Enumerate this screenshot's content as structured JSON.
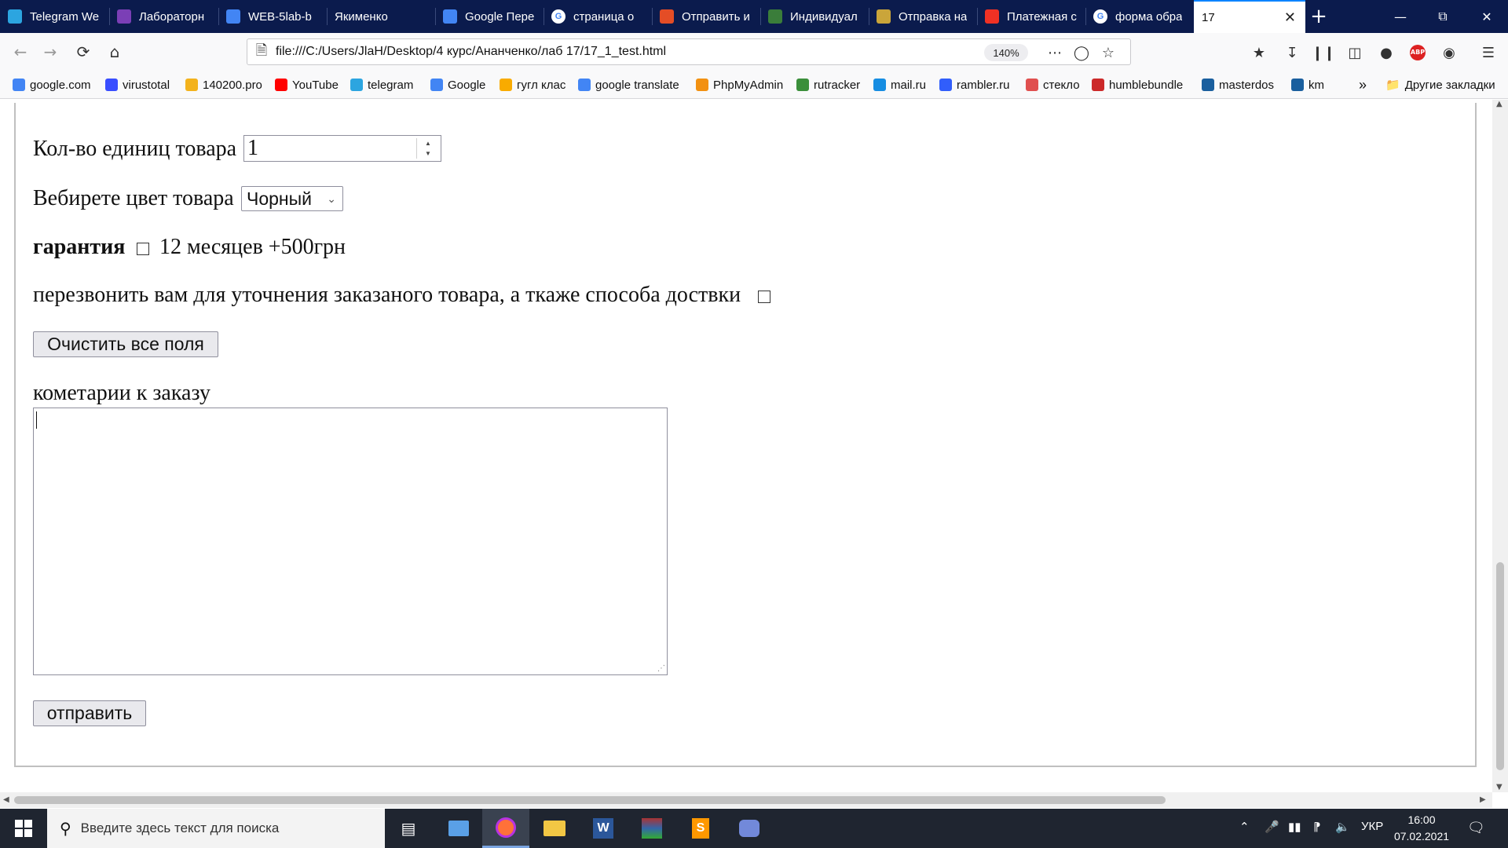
{
  "tabs": [
    {
      "title": "Telegram We",
      "icon": "telegram-icon",
      "color": "#2ca5e0"
    },
    {
      "title": "Лабораторн",
      "icon": "classroom-icon",
      "color": "#7b3fb6"
    },
    {
      "title": "WEB-5lab-b",
      "icon": "docs-icon",
      "color": "#4285f4"
    },
    {
      "title": "Якименко",
      "icon": "blank-icon",
      "color": "#0b1b4d"
    },
    {
      "title": "Google Пере",
      "icon": "translate-icon",
      "color": "#4285f4"
    },
    {
      "title": "страница о",
      "icon": "google-icon",
      "color": "#ffffff"
    },
    {
      "title": "Отправить и",
      "icon": "code-icon",
      "color": "#e44d26"
    },
    {
      "title": "Индивидуал",
      "icon": "person-icon",
      "color": "#3a7d3a"
    },
    {
      "title": "Отправка на",
      "icon": "dollar-icon",
      "color": "#caa53a"
    },
    {
      "title": "Платежная с",
      "icon": "alfa-icon",
      "color": "#ef3124"
    },
    {
      "title": "форма обра",
      "icon": "google-icon",
      "color": "#ffffff"
    },
    {
      "title": "17",
      "icon": "blank-icon",
      "color": "#ffffff",
      "active": true
    }
  ],
  "nav": {
    "url": "file:///C:/Users/JlaH/Desktop/4 курс/Ананченко/лаб 17/17_1_test.html",
    "zoom": "140%"
  },
  "bookmarks": [
    {
      "label": "google.com",
      "icon": "google-icon",
      "color": "#4285f4"
    },
    {
      "label": "virustotal",
      "icon": "virustotal-icon",
      "color": "#394eff"
    },
    {
      "label": "140200.pro",
      "icon": "ab-icon",
      "color": "#f3b21c"
    },
    {
      "label": "YouTube",
      "icon": "youtube-icon",
      "color": "#ff0000"
    },
    {
      "label": "telegram",
      "icon": "telegram-icon",
      "color": "#2ca5e0"
    },
    {
      "label": "Google",
      "icon": "google-icon",
      "color": "#4285f4"
    },
    {
      "label": "гугл клас",
      "icon": "classroom-icon",
      "color": "#f9ab00"
    },
    {
      "label": "google translate",
      "icon": "translate-icon",
      "color": "#4285f4"
    },
    {
      "label": "PhpMyAdmin",
      "icon": "phpmyadmin-icon",
      "color": "#f29111"
    },
    {
      "label": "rutracker",
      "icon": "rutracker-icon",
      "color": "#3b8f3b"
    },
    {
      "label": "mail.ru",
      "icon": "mailru-icon",
      "color": "#168de2"
    },
    {
      "label": "rambler.ru",
      "icon": "envelope-icon",
      "color": "#315efb"
    },
    {
      "label": "стекло",
      "icon": "glass-icon",
      "color": "#e0504f"
    },
    {
      "label": "humblebundle",
      "icon": "humble-icon",
      "color": "#cc2929"
    },
    {
      "label": "masterdos",
      "icon": "s-icon",
      "color": "#1a5f9e"
    },
    {
      "label": "km",
      "icon": "s-icon",
      "color": "#1a5f9e"
    }
  ],
  "bookmarks_other": "Другие закладки",
  "form": {
    "qty_label": "Кол-во единиц товара",
    "qty_value": "1",
    "color_label": "Вебирете цвет товара",
    "color_value": "Чорный",
    "warranty_label": "гарантия",
    "warranty_option": "12 месяцев +500грн",
    "callback_label": "перезвонить вам для уточнения заказаного товара, а ткаже способа доствки",
    "reset_button": "Очистить все поля",
    "comment_label": "кометарии к заказу",
    "comment_value": "",
    "submit_button": "отправить"
  },
  "taskbar": {
    "search_placeholder": "Введите здесь текст для поиска",
    "lang": "УКР",
    "time": "16:00",
    "date": "07.02.2021"
  }
}
